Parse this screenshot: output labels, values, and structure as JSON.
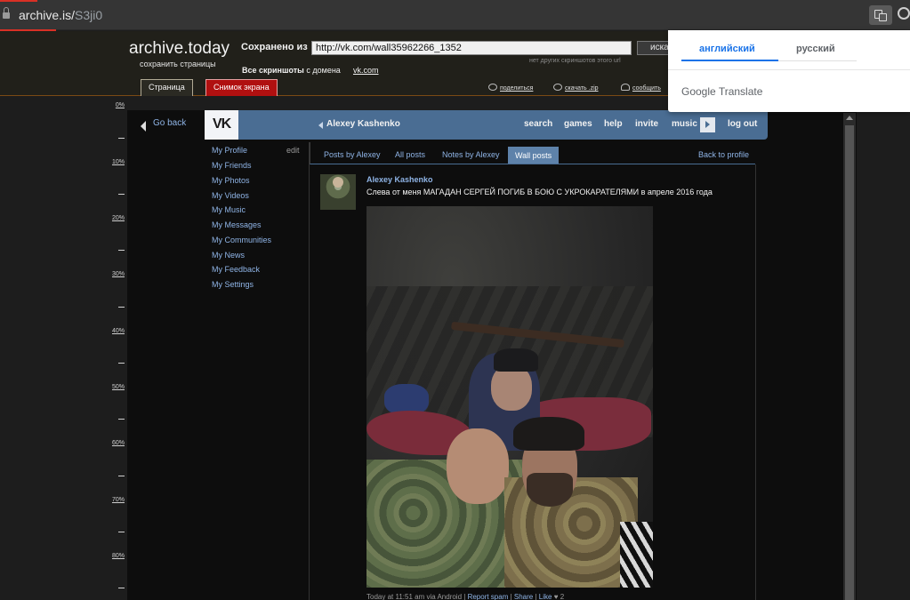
{
  "browser": {
    "url_host": "archive.is/",
    "url_path": "S3ji0"
  },
  "archive": {
    "logo": "archive.today",
    "logo_sub": "сохранить страницы",
    "saved_from_label": "Сохранено из",
    "saved_url": "http://vk.com/wall35962266_1352",
    "search_btn": "иска",
    "no_other": "нет других скриншотов этого url",
    "all_screens": "Все скриншоты",
    "from_domain": "с домена",
    "domain": "vk.com",
    "tab_page": "Страница",
    "tab_screenshot": "Снимок экрана",
    "share": "поделиться",
    "download": "скачать .zip",
    "report": "сообщить"
  },
  "ruler": {
    "labels": [
      "0%",
      "10%",
      "20%",
      "30%",
      "40%",
      "50%",
      "60%",
      "70%",
      "80%"
    ]
  },
  "vk": {
    "go_back": "Go back",
    "logo": "VK",
    "user_name": "Alexey Kashenko",
    "nav": [
      "search",
      "games",
      "help",
      "invite",
      "music",
      "log out"
    ],
    "menu": [
      "My Profile",
      "My Friends",
      "My Photos",
      "My Videos",
      "My Music",
      "My Messages",
      "My Communities",
      "My News",
      "My Feedback",
      "My Settings"
    ],
    "menu_edit": "edit",
    "wall_tabs": [
      "Posts by Alexey",
      "All posts",
      "Notes by Alexey",
      "Wall posts"
    ],
    "back_to_profile": "Back to profile",
    "post": {
      "author": "Alexey Kashenko",
      "text": "Слева от меня МАГАДАН СЕРГЕЙ ПОГИБ В БОЮ С УКРОКАРАТЕЛЯМИ в апреле 2016 года",
      "footer_time": "Today at 11:51 am via Android",
      "footer_report": "Report spam",
      "footer_share": "Share",
      "footer_like": "Like",
      "footer_like_count": "2"
    }
  },
  "translate_popup": {
    "lang_source": "английский",
    "lang_target": "русский",
    "brand": "Google Translate"
  },
  "colors": {
    "vk_blue": "#4a6d93",
    "link_blue": "#8fb4e6",
    "archive_red": "#b01010",
    "google_blue": "#1a73e8"
  }
}
